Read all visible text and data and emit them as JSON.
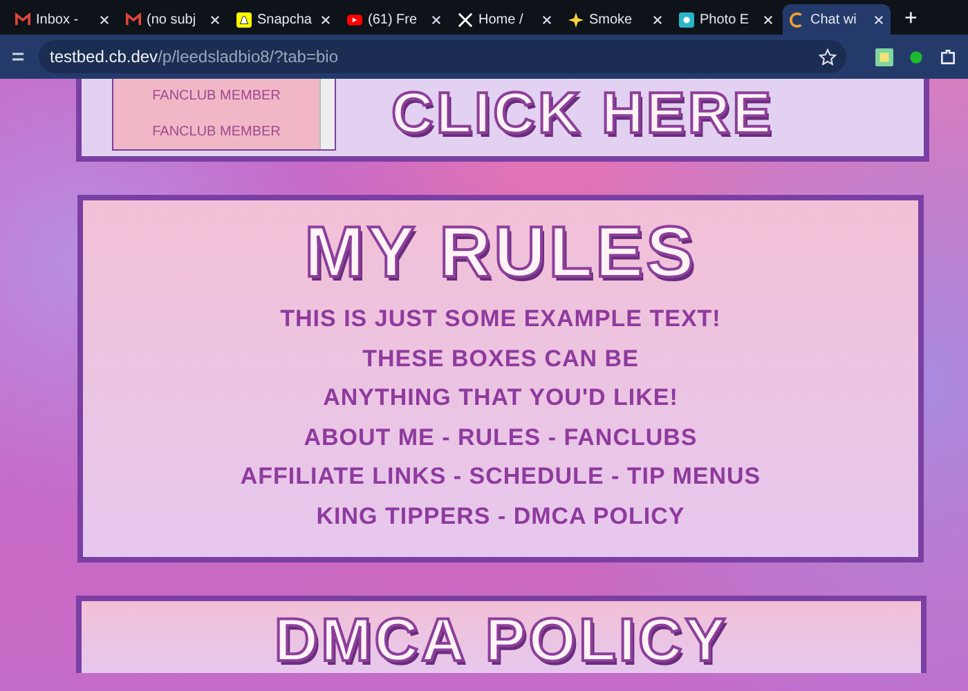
{
  "tabs": [
    {
      "title": "Inbox -",
      "selected": false
    },
    {
      "title": "(no subj",
      "selected": false
    },
    {
      "title": "Snapcha",
      "selected": false
    },
    {
      "title": "(61) Fre",
      "selected": false
    },
    {
      "title": "Home /",
      "selected": false
    },
    {
      "title": "Smoke",
      "selected": false
    },
    {
      "title": "Photo E",
      "selected": false
    },
    {
      "title": "Chat wi",
      "selected": true
    }
  ],
  "new_tab": "+",
  "address_bar": {
    "host": "testbed.cb.dev",
    "path": "/p/leedsladbio8/?tab=bio"
  },
  "top_panel": {
    "list_items": [
      "FANCLUB MEMBER",
      "FANCLUB MEMBER"
    ],
    "banner": "CLICK HERE"
  },
  "rules_panel": {
    "title": "MY RULES",
    "lines": [
      "THIS IS JUST SOME EXAMPLE TEXT!",
      "THESE BOXES CAN BE",
      "ANYTHING THAT YOU'D LIKE!",
      "ABOUT ME - RULES - FANCLUBS",
      "AFFILIATE LINKS - SCHEDULE - TIP MENUS",
      "KING TIPPERS - DMCA POLICY"
    ]
  },
  "bottom_panel": {
    "title": "DMCA POLICY"
  }
}
